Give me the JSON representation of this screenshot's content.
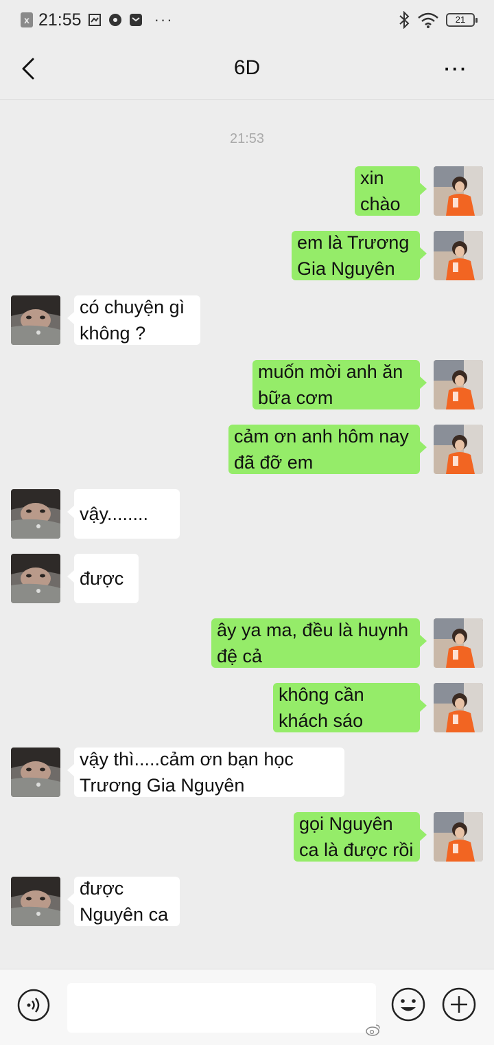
{
  "status_bar": {
    "time": "21:55",
    "battery": "21",
    "more": "···"
  },
  "header": {
    "title": "6D",
    "more": "···"
  },
  "chat": {
    "timestamp": "21:53",
    "messages": [
      {
        "side": "right",
        "text": "xin chào"
      },
      {
        "side": "right",
        "text": "em là Trương Gia Nguyên"
      },
      {
        "side": "left",
        "text": "có chuyện gì không ?"
      },
      {
        "side": "right",
        "text": "muốn mời anh ăn bữa cơm"
      },
      {
        "side": "right",
        "text": "cảm ơn anh hôm nay đã đỡ em"
      },
      {
        "side": "left",
        "text": "vậy........"
      },
      {
        "side": "left",
        "text": "được"
      },
      {
        "side": "right",
        "text": "ây ya ma, đều là huynh đệ cả"
      },
      {
        "side": "right",
        "text": "không cần khách sáo"
      },
      {
        "side": "left",
        "text": "vậy thì.....cảm ơn bạn học Trương Gia Nguyên"
      },
      {
        "side": "right",
        "text": "gọi Nguyên ca là được rồi"
      },
      {
        "side": "left",
        "text": "được Nguyên ca"
      }
    ]
  },
  "input_bar": {
    "value": "",
    "icons": [
      "voice-icon",
      "emoji-icon",
      "plus-icon"
    ]
  },
  "colors": {
    "background": "#ededed",
    "outgoing_bubble": "#95ec69",
    "incoming_bubble": "#ffffff",
    "timestamp": "#aaaaaa"
  }
}
